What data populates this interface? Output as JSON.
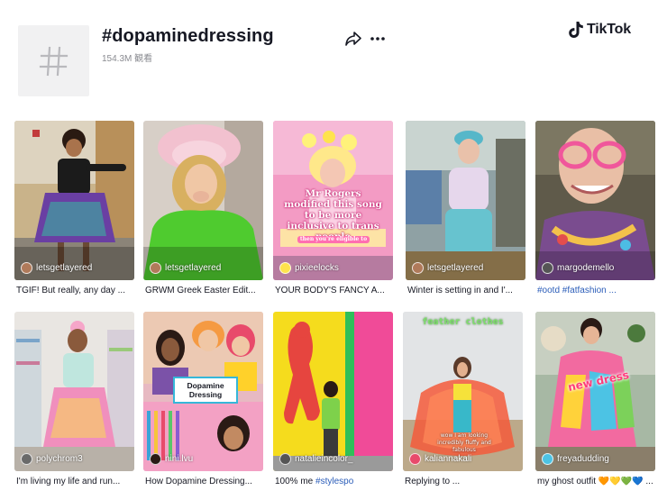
{
  "header": {
    "hashtag": "#dopaminedressing",
    "views": "154.3M 観看",
    "brand": "TikTok"
  },
  "videos": [
    {
      "author": "letsgetlayered",
      "caption": "TGIF! But really, any day ..."
    },
    {
      "author": "letsgetlayered",
      "caption": "GRWM Greek Easter Edit..."
    },
    {
      "author": "pixieelocks",
      "caption": "YOUR BODY'S FANCY A...",
      "overlay": "Mr Rogers modified this song to be more inclusive to trans people",
      "overlay2": "then you're eligible to"
    },
    {
      "author": "letsgetlayered",
      "caption": "Winter is setting in and I'..."
    },
    {
      "author": "margodemello",
      "caption_tags": "#ootd #fatfashion ..."
    },
    {
      "author": "polychrom3",
      "caption": "I'm living my life and run..."
    },
    {
      "author": "nini.lvu",
      "caption": "How Dopamine Dressing...",
      "badge": "Dopamine Dressing"
    },
    {
      "author": "natalieincolor_",
      "caption_plain": "100% me ",
      "caption_tag": "#stylespo"
    },
    {
      "author": "kaliannakali",
      "caption": "Replying to ...",
      "overlay": "feather clothes",
      "overlay2": "wow I am looking incredibly fluffy and fabulous"
    },
    {
      "author": "freyadudding",
      "caption": "my ghost outfit 🧡💛💚💙 ...",
      "overlay": "new dress"
    }
  ],
  "colors": {
    "text": "#161823",
    "muted": "#8a8b91",
    "hashtag_link": "#2b5db9",
    "tile_bg": "#f1f1f2"
  }
}
